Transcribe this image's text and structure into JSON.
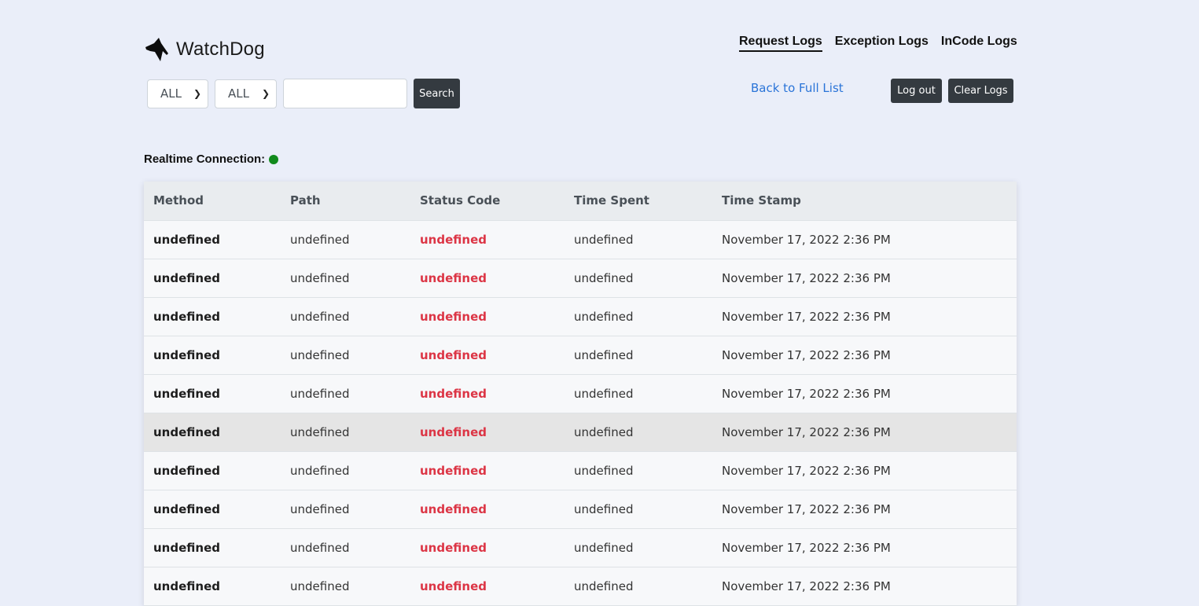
{
  "brand": {
    "name": "WatchDog",
    "icon": "dog-head-icon"
  },
  "nav": {
    "items": [
      {
        "label": "Request Logs",
        "active": true
      },
      {
        "label": "Exception Logs",
        "active": false
      },
      {
        "label": "InCode Logs",
        "active": false
      }
    ]
  },
  "filters": {
    "method_select": "ALL",
    "status_select": "ALL",
    "search_value": "",
    "search_label": "Search"
  },
  "actions": {
    "back_link": "Back to Full List",
    "logout_label": "Log out",
    "clear_label": "Clear Logs"
  },
  "realtime": {
    "label": "Realtime Connection:",
    "status_color": "#118a1d"
  },
  "table": {
    "headers": [
      "Method",
      "Path",
      "Status Code",
      "Time Spent",
      "Time Stamp"
    ],
    "rows": [
      [
        "undefined",
        "undefined",
        "undefined",
        "undefined",
        "November 17, 2022 2:36 PM"
      ],
      [
        "undefined",
        "undefined",
        "undefined",
        "undefined",
        "November 17, 2022 2:36 PM"
      ],
      [
        "undefined",
        "undefined",
        "undefined",
        "undefined",
        "November 17, 2022 2:36 PM"
      ],
      [
        "undefined",
        "undefined",
        "undefined",
        "undefined",
        "November 17, 2022 2:36 PM"
      ],
      [
        "undefined",
        "undefined",
        "undefined",
        "undefined",
        "November 17, 2022 2:36 PM"
      ],
      [
        "undefined",
        "undefined",
        "undefined",
        "undefined",
        "November 17, 2022 2:36 PM"
      ],
      [
        "undefined",
        "undefined",
        "undefined",
        "undefined",
        "November 17, 2022 2:36 PM"
      ],
      [
        "undefined",
        "undefined",
        "undefined",
        "undefined",
        "November 17, 2022 2:36 PM"
      ],
      [
        "undefined",
        "undefined",
        "undefined",
        "undefined",
        "November 17, 2022 2:36 PM"
      ],
      [
        "undefined",
        "undefined",
        "undefined",
        "undefined",
        "November 17, 2022 2:36 PM"
      ]
    ]
  },
  "colors": {
    "background": "#eaeef9",
    "status_error": "#dc3545",
    "link": "#2a74d8",
    "button_dark": "#343a40"
  }
}
